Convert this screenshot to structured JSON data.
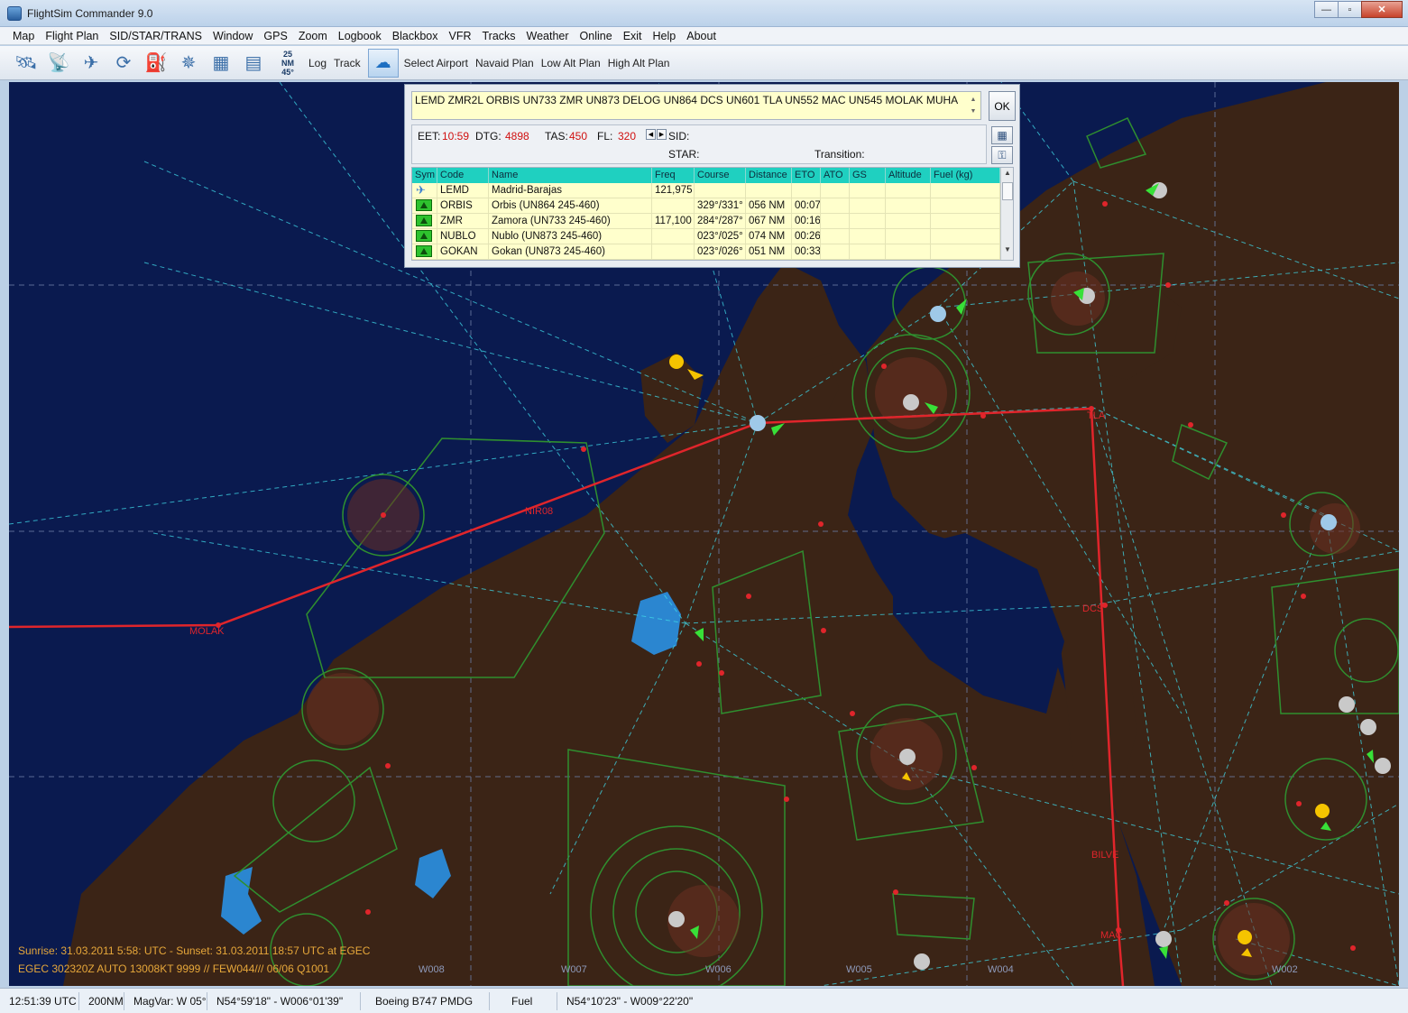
{
  "window": {
    "title": "FlightSim Commander 9.0",
    "min_label": "—",
    "max_label": "▫",
    "close_label": "✕"
  },
  "menu": [
    "Map",
    "Flight Plan",
    "SID/STAR/TRANS",
    "Window",
    "GPS",
    "Zoom",
    "Logbook",
    "Blackbox",
    "VFR",
    "Tracks",
    "Weather",
    "Online",
    "Exit",
    "Help",
    "About"
  ],
  "toolbar": {
    "zoom_top": "25",
    "zoom_unit": "NM",
    "zoom_angle": "45°",
    "log": "Log",
    "track": "Track",
    "select_airport": "Select Airport",
    "navaid_plan": "Navaid Plan",
    "low_alt_plan": "Low Alt Plan",
    "high_alt_plan": "High Alt Plan"
  },
  "flightplan": {
    "route": "LEMD ZMR2L ORBIS UN733 ZMR UN873 DELOG UN864 DCS UN601 TLA UN552 MAC UN545 MOLAK MUHA",
    "ok": "OK",
    "eet_label": "EET:",
    "eet": "10:59",
    "dtg_label": "DTG:",
    "dtg": "4898",
    "tas_label": "TAS:",
    "tas": "450",
    "fl_label": "FL:",
    "fl": "320",
    "sid_label": "SID:",
    "star_label": "STAR:",
    "transition_label": "Transition:",
    "columns": [
      "Sym",
      "Code",
      "Name",
      "Freq",
      "Course",
      "Distance",
      "ETO",
      "ATO",
      "GS",
      "Altitude",
      "Fuel (kg)"
    ],
    "rows": [
      {
        "sym": "airport",
        "code": "LEMD",
        "name": "Madrid-Barajas",
        "freq": "121,975",
        "course": "",
        "distance": "",
        "eto": ""
      },
      {
        "sym": "waypoint",
        "code": "ORBIS",
        "name": "Orbis (UN864 245-460)",
        "freq": "",
        "course": "329°/331°",
        "distance": "056 NM",
        "eto": "00:07"
      },
      {
        "sym": "waypoint",
        "code": "ZMR",
        "name": "Zamora (UN733 245-460)",
        "freq": "117,100",
        "course": "284°/287°",
        "distance": "067 NM",
        "eto": "00:16"
      },
      {
        "sym": "waypoint",
        "code": "NUBLO",
        "name": "Nublo (UN873 245-460)",
        "freq": "",
        "course": "023°/025°",
        "distance": "074 NM",
        "eto": "00:26"
      },
      {
        "sym": "waypoint",
        "code": "GOKAN",
        "name": "Gokan (UN873 245-460)",
        "freq": "",
        "course": "023°/026°",
        "distance": "051 NM",
        "eto": "00:33"
      }
    ]
  },
  "map": {
    "sun_info": "Sunrise: 31.03.2011 5:58: UTC  -  Sunset: 31.03.2011 18:57 UTC at EGEC",
    "metar": "EGEC 302320Z AUTO 13008KT 9999 // FEW044/// 06/06 Q1001",
    "labels": {
      "molak": "MOLAK",
      "bilve": "BILVE",
      "nir": "NIR08",
      "tla": "TLA",
      "dcs": "DCS",
      "mac": "MAC"
    },
    "longitudes": [
      "W008",
      "W007",
      "W006",
      "W005",
      "W004",
      "W002"
    ],
    "colors": {
      "sea": "#0a1a4f",
      "land": "#3b2416",
      "route": "#e0252b",
      "airway": "#3fd8e8",
      "airspace": "#2f8f2f"
    }
  },
  "status": {
    "time": "12:51:39 UTC",
    "range": "200NM",
    "magvar": "MagVar: W 05°",
    "position": "N54°59'18\" - W006°01'39\"",
    "aircraft": "Boeing B747 PMDG",
    "fuel": "Fuel",
    "cursor": "N54°10'23\" - W009°22'20\""
  }
}
